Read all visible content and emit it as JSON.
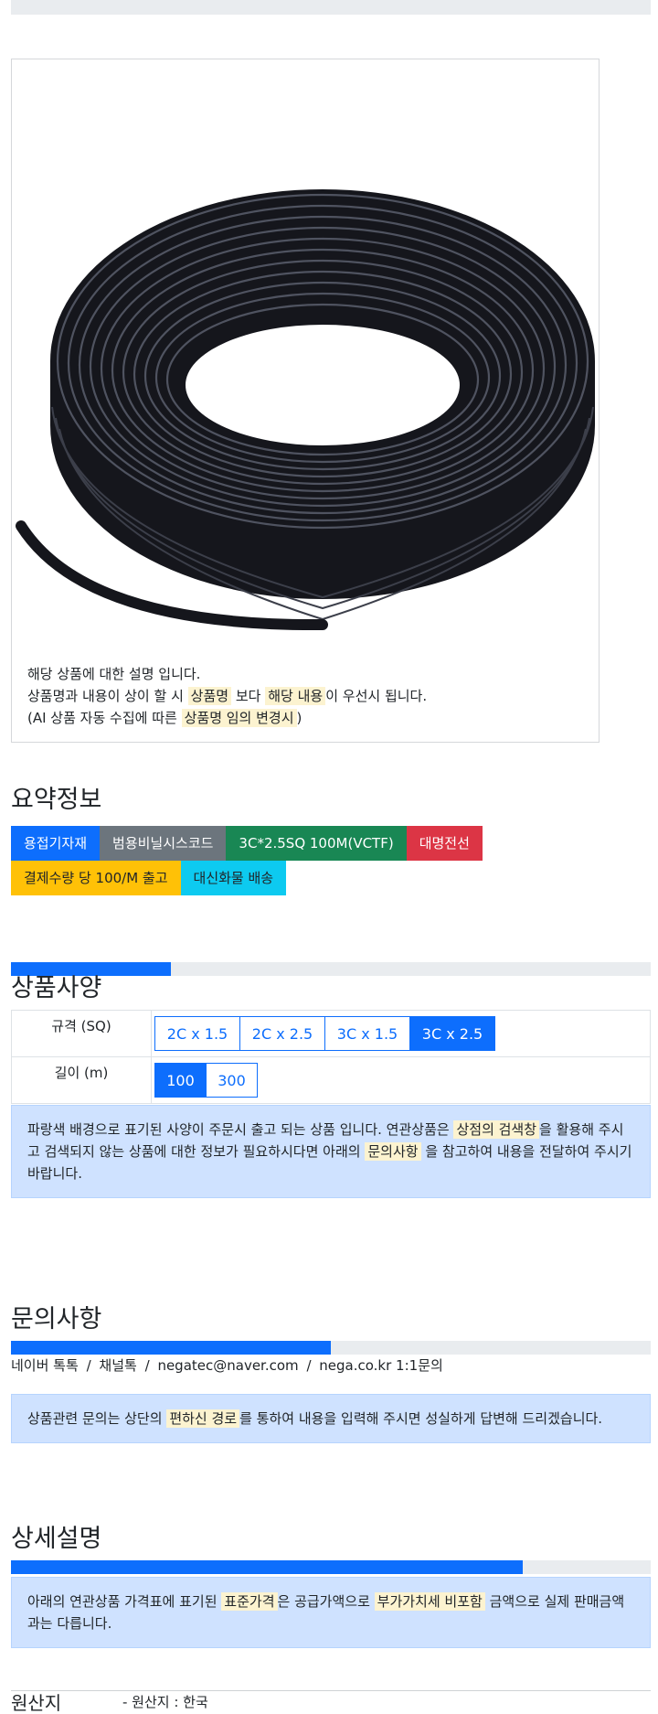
{
  "product_card": {
    "image_alt": "black cable coil",
    "desc_line1": "해당 상품에 대한 설명 입니다.",
    "desc_line2_a": "상품명과 내용이 상이 할 시",
    "desc_line2_mark1": "상품명",
    "desc_line2_b": "보다",
    "desc_line2_mark2": "해당 내용",
    "desc_line2_c": "이 우선시 됩니다.",
    "desc_line3_a": "(AI 상품 자동 수집에 따른",
    "desc_line3_mark": "상품명 임의 변경시",
    "desc_line3_b": ")"
  },
  "summary": {
    "title": "요약정보",
    "badges": [
      {
        "label": "용접기자재",
        "color": "#0d6efd"
      },
      {
        "label": "범용비닐시스코드",
        "color": "#6c757d"
      },
      {
        "label": "3C*2.5SQ 100M(VCTF)",
        "color": "#198754"
      },
      {
        "label": "대명전선",
        "color": "#dc3545"
      },
      {
        "label": "결제수량 당 100/M 출고",
        "color": "#ffc107"
      },
      {
        "label": "대신화물 배송",
        "color": "#0dcaf0"
      }
    ]
  },
  "spec": {
    "progress": 0.25,
    "title": "상품사양",
    "rows": [
      {
        "label": "규격 (SQ)",
        "options": [
          "2C x 1.5",
          "2C x 2.5",
          "3C x 1.5",
          "3C x 2.5"
        ],
        "selected": "3C x 2.5"
      },
      {
        "label": "길이 (m)",
        "options": [
          "100",
          "300"
        ],
        "selected": "100"
      }
    ],
    "notice_a": "파랑색 배경으로 표기된 사양이 주문시 출고 되는 상품 입니다. 연관상품은",
    "notice_mark1": "상점의 검색창",
    "notice_b": "을 활용해 주시고 검색되지 않는 상품에 대한 정보가 필요하시다면 아래의",
    "notice_mark2": "문의사항",
    "notice_c": "을 참고하여 내용을 전달하여 주시기 바랍니다."
  },
  "inquiry": {
    "title": "문의사항",
    "progress": 0.5,
    "channels": [
      "네이버 톡톡",
      "채널톡",
      "negatec@naver.com",
      "nega.co.kr 1:1문의"
    ],
    "separator": "/",
    "notice_a": "상품관련 문의는 상단의",
    "notice_mark": "편하신 경로",
    "notice_b": "를 통하여 내용을 입력해 주시면 성실하게 답변해 드리겠습니다."
  },
  "detail": {
    "title": "상세설명",
    "progress": 0.8,
    "notice_a": "아래의 연관상품 가격표에 표기된",
    "notice_mark1": "표준가격",
    "notice_b": "은 공급가액으로",
    "notice_mark2": "부가가치세 비포함",
    "notice_c": "금액으로 실제 판매금액과는 다릅니다."
  },
  "origin": {
    "label": "원산지",
    "value": "- 원산지 : 한국"
  }
}
